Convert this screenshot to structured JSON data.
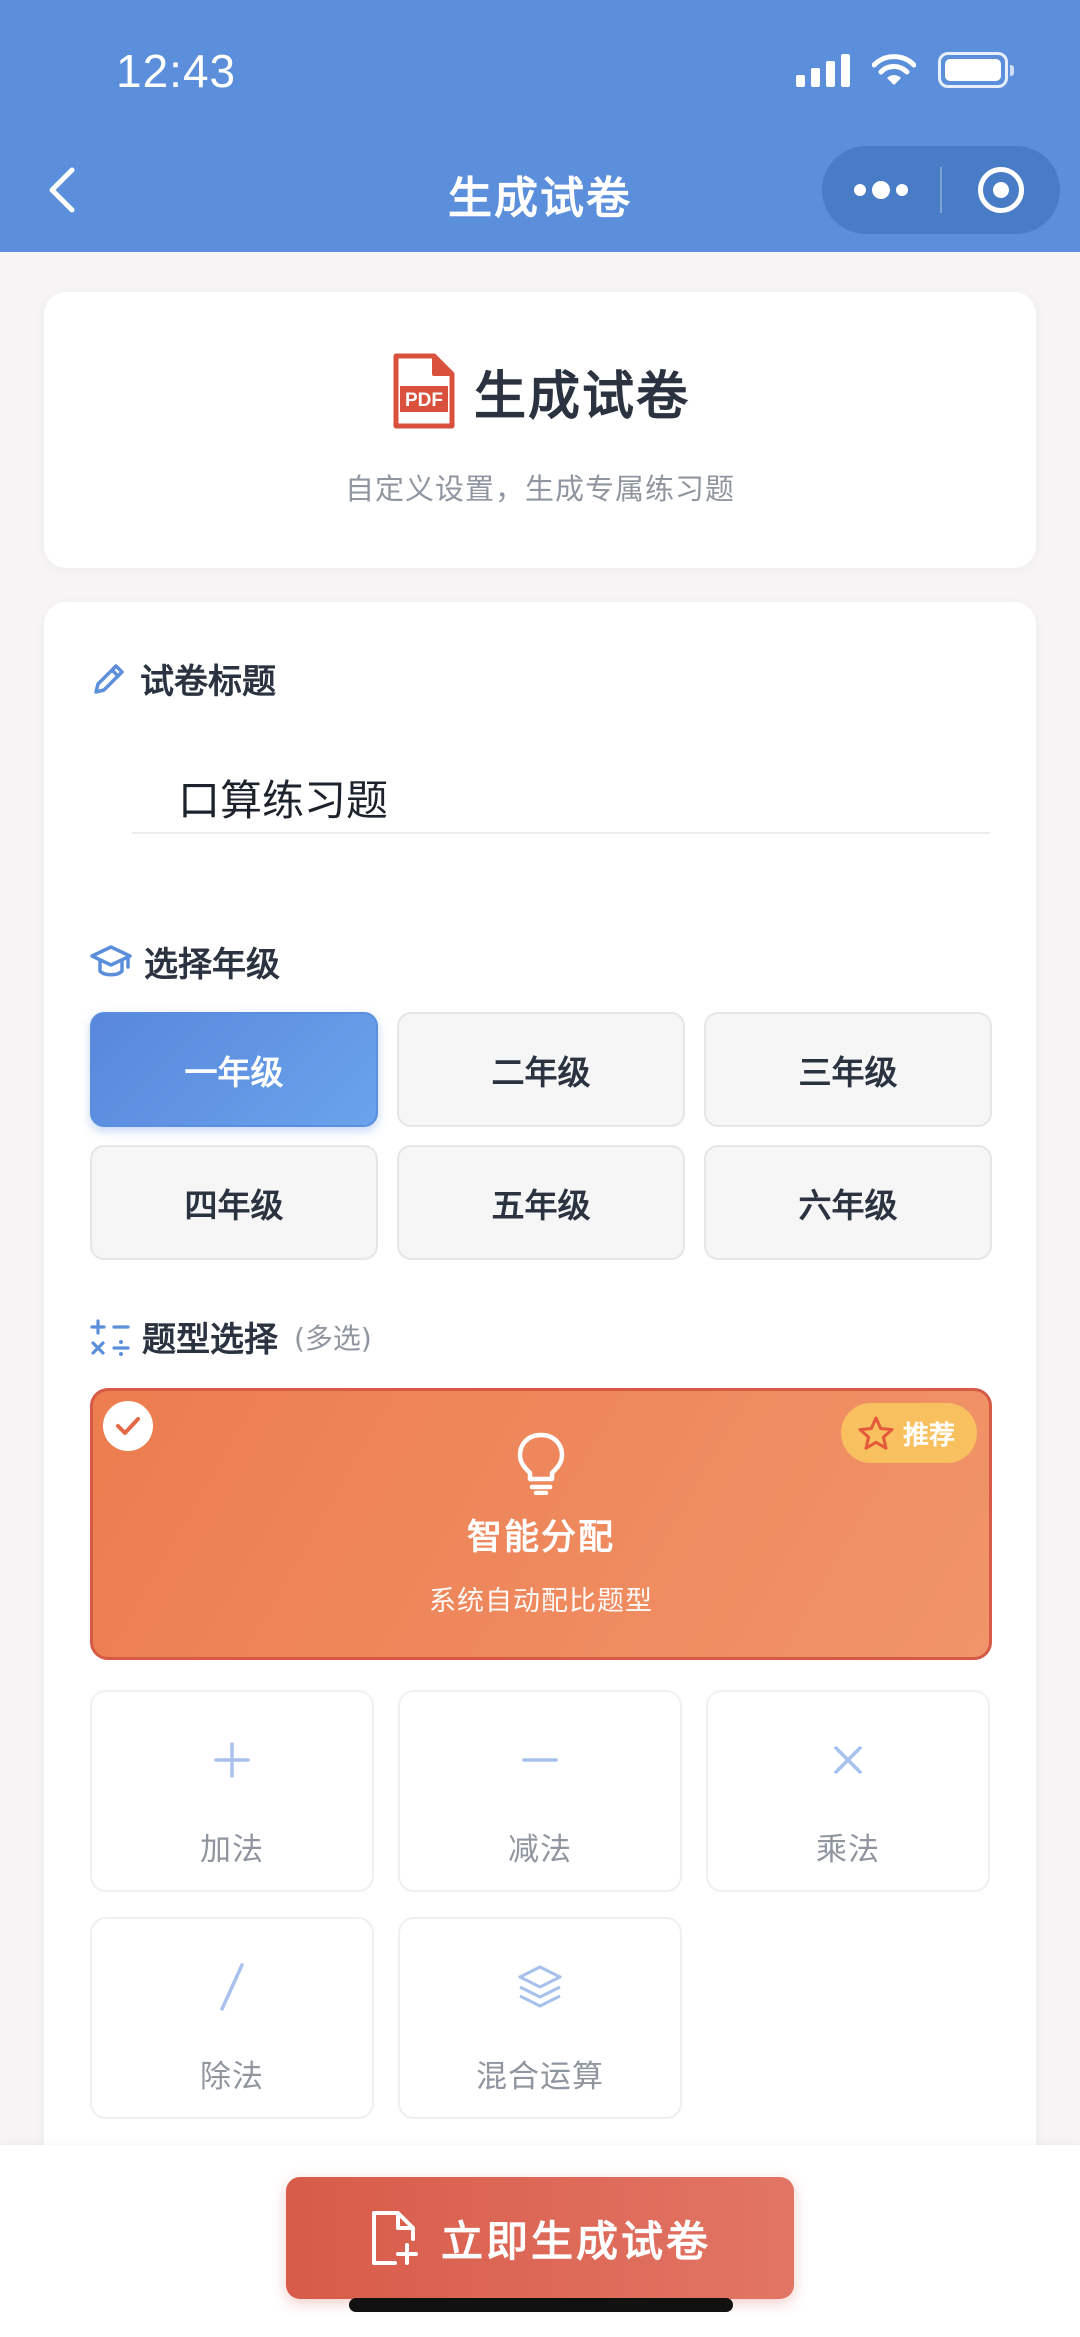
{
  "status_bar": {
    "time": "12:43"
  },
  "nav": {
    "title": "生成试卷"
  },
  "hero": {
    "icon_text": "PDF",
    "title": "生成试卷",
    "subtitle": "自定义设置，生成专属练习题"
  },
  "paper_title": {
    "label": "试卷标题",
    "value": "口算练习题"
  },
  "grade": {
    "label": "选择年级",
    "selected": "一年级",
    "options": [
      "一年级",
      "二年级",
      "三年级",
      "四年级",
      "五年级",
      "六年级"
    ]
  },
  "question_type": {
    "label": "题型选择",
    "hint": "(多选)",
    "smart": {
      "name": "智能分配",
      "description": "系统自动配比题型",
      "badge": "推荐",
      "checked": true
    },
    "options": [
      {
        "label": "加法",
        "icon": "plus-icon"
      },
      {
        "label": "减法",
        "icon": "minus-icon"
      },
      {
        "label": "乘法",
        "icon": "multiply-icon"
      },
      {
        "label": "除法",
        "icon": "divide-icon"
      },
      {
        "label": "混合运算",
        "icon": "layers-icon"
      }
    ]
  },
  "action": {
    "generate_label": "立即生成试卷"
  },
  "colors": {
    "header": "#5b8fdb",
    "grade_active": "#5a8fe0",
    "smart_card": "#ec7d4f",
    "badge": "#f9c060",
    "cta": "#d85b49"
  }
}
